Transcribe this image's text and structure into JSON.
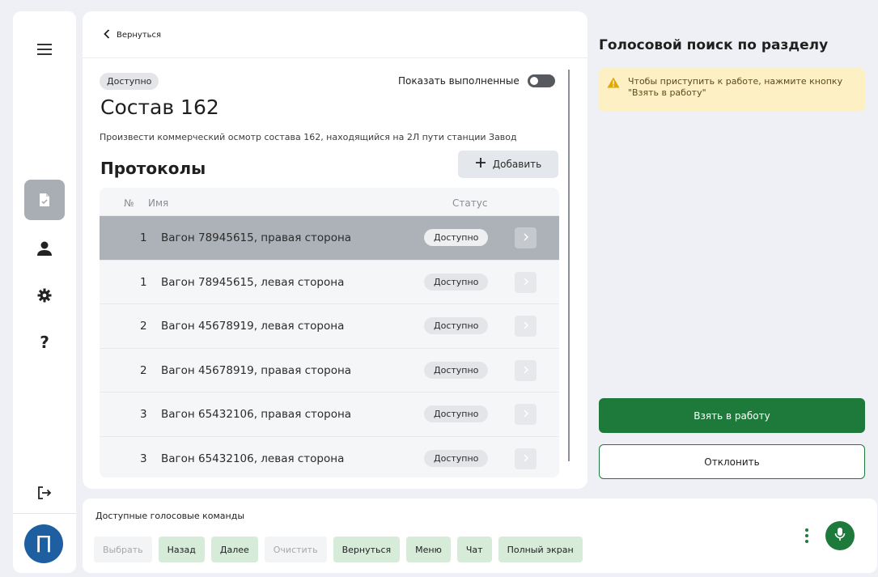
{
  "sidebar": {
    "items": [
      {
        "icon": "menu-icon"
      },
      {
        "icon": "document-check-icon",
        "active": true
      },
      {
        "icon": "user-icon"
      },
      {
        "icon": "gear-icon"
      },
      {
        "icon": "help-icon",
        "glyph": "?"
      },
      {
        "icon": "logout-icon"
      }
    ],
    "avatar_letter": "П"
  },
  "main": {
    "back_label": "Вернуться",
    "status_badge": "Доступно",
    "show_completed_label": "Показать выполненные",
    "show_completed_on": false,
    "title": "Состав 162",
    "description": "Произвести коммерческий осмотр состава 162, находящийся на 2Л пути станции Завод",
    "protocols_title": "Протоколы",
    "add_button_label": "Добавить",
    "table": {
      "headers": {
        "num": "№",
        "name": "Имя",
        "status": "Статус"
      },
      "rows": [
        {
          "num": "1",
          "name": "Вагон 78945615, правая сторона",
          "status": "Доступно",
          "selected": true
        },
        {
          "num": "1",
          "name": "Вагон 78945615, левая сторона",
          "status": "Доступно",
          "selected": false
        },
        {
          "num": "2",
          "name": "Вагон 45678919, левая сторона",
          "status": "Доступно",
          "selected": false
        },
        {
          "num": "2",
          "name": "Вагон 45678919, правая сторона",
          "status": "Доступно",
          "selected": false
        },
        {
          "num": "3",
          "name": "Вагон 65432106, правая сторона",
          "status": "Доступно",
          "selected": false
        },
        {
          "num": "3",
          "name": "Вагон 65432106, левая сторона",
          "status": "Доступно",
          "selected": false
        }
      ]
    }
  },
  "right_panel": {
    "title": "Голосовой поиск по разделу",
    "warning_text": "Чтобы приступить к работе, нажмите кнопку \"Взять в работу\"",
    "take_button": "Взять в работу",
    "decline_button": "Отклонить"
  },
  "bottom_bar": {
    "title": "Доступные голосовые команды",
    "commands": [
      {
        "label": "Выбрать",
        "enabled": false
      },
      {
        "label": "Назад",
        "enabled": true
      },
      {
        "label": "Далее",
        "enabled": true
      },
      {
        "label": "Очистить",
        "enabled": false
      },
      {
        "label": "Вернуться",
        "enabled": true
      },
      {
        "label": "Меню",
        "enabled": true
      },
      {
        "label": "Чат",
        "enabled": true
      },
      {
        "label": "Полный экран",
        "enabled": true
      }
    ]
  },
  "colors": {
    "accent_green": "#1e7a3b",
    "command_green_bg": "#d7ebd9",
    "warning_bg": "#fdf0c4",
    "warning_icon": "#e0a800",
    "avatar_blue": "#1d5fa0",
    "selected_row": "#adb2b8"
  }
}
